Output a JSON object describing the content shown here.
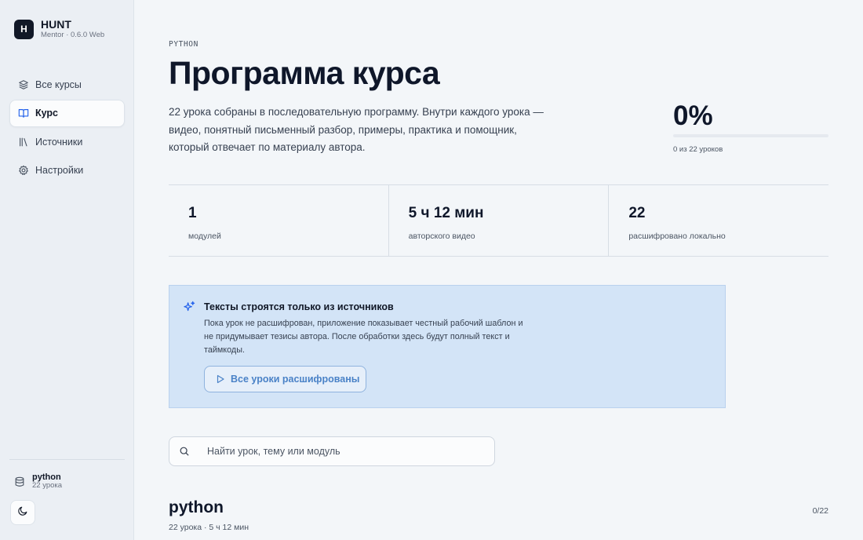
{
  "brand": {
    "logo": "H",
    "name": "HUNT",
    "subtitle": "Mentor · 0.6.0 Web"
  },
  "sidebar": {
    "items": [
      {
        "label": "Все курсы",
        "icon": "layers-icon",
        "active": false
      },
      {
        "label": "Курс",
        "icon": "book-open-icon",
        "active": true
      },
      {
        "label": "Источники",
        "icon": "library-icon",
        "active": false
      },
      {
        "label": "Настройки",
        "icon": "gear-icon",
        "active": false
      }
    ],
    "course": {
      "name": "python",
      "count": "22 урока",
      "icon": "database-icon"
    },
    "theme_icon": "moon-icon"
  },
  "header": {
    "eyebrow": "PYTHON",
    "title": "Программа курса",
    "description": "22 урока собраны в последовательную программу. Внутри каждого урока — видео, понятный письменный разбор, примеры, практика и помощник, который отвечает по материалу автора."
  },
  "progress": {
    "percent_label": "0%",
    "value": 0,
    "caption": "0 из 22 уроков"
  },
  "stats": [
    {
      "value": "1",
      "label": "модулей"
    },
    {
      "value": "5 ч 12 мин",
      "label": "авторского видео"
    },
    {
      "value": "22",
      "label": "расшифровано локально"
    }
  ],
  "notice": {
    "icon": "sparkles-icon",
    "title": "Тексты строятся только из источников",
    "text": "Пока урок не расшифрован, приложение показывает честный рабочий шаблон и не придумывает тезисы автора. После обработки здесь будут полный текст и таймкоды.",
    "button_label": "Все уроки расшифрованы",
    "button_icon": "play-icon"
  },
  "search": {
    "placeholder": "Найти урок, тему или модуль",
    "value": ""
  },
  "module": {
    "title": "python",
    "meta": "22 урока · 5 ч 12 мин",
    "count": "0/22"
  },
  "colors": {
    "accent": "#2563eb",
    "notice_bg": "#d3e4f7",
    "notice_button_text": "#4a82c7"
  }
}
